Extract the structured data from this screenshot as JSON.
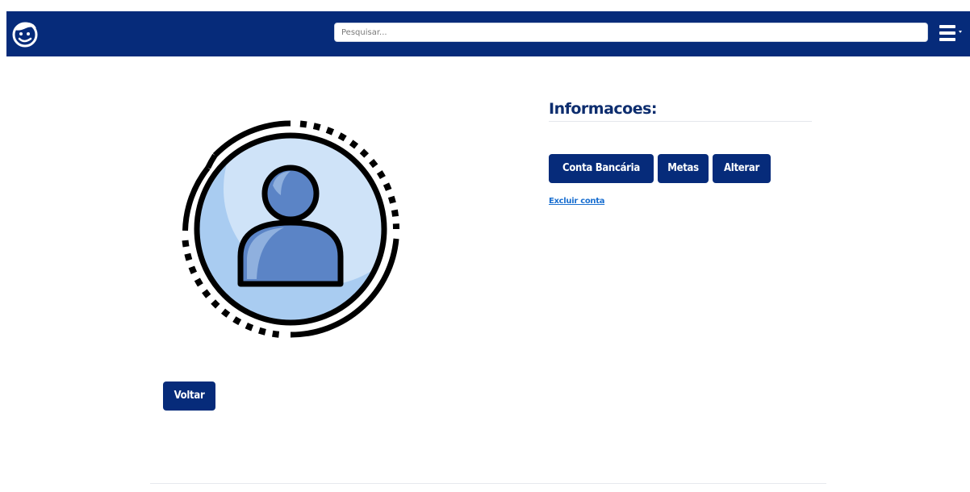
{
  "navbar": {
    "logo_icon": "smiling-face-icon",
    "search_placeholder": "Pesquisar...",
    "menu_icon": "hamburger-menu-icon",
    "background_color": "#062b7a"
  },
  "profile": {
    "avatar_icon": "user-avatar-icon",
    "back_label": "Voltar"
  },
  "info": {
    "title": "Informacoes:",
    "buttons": {
      "bank_account": "Conta Bancária",
      "goals": "Metas",
      "edit": "Alterar"
    },
    "delete_account": "Excluir conta"
  },
  "colors": {
    "primary": "#062b7a",
    "link": "#1a6fd0",
    "avatar_fill": "#a9ccf1",
    "avatar_person": "#5b84c6"
  }
}
